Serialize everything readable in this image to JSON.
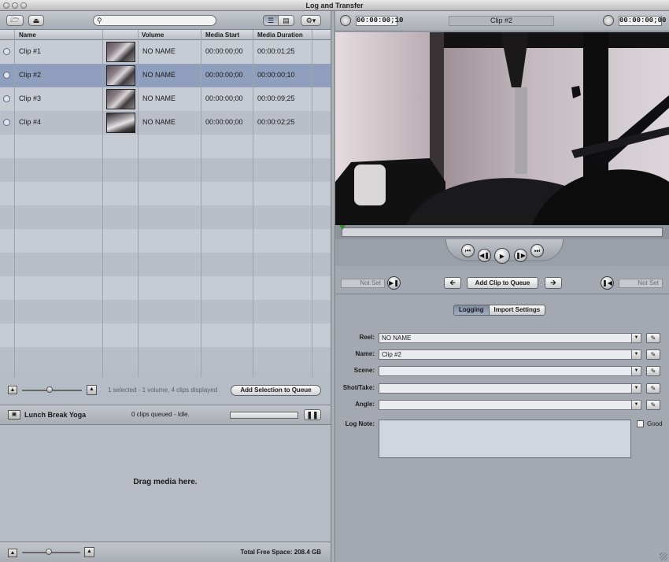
{
  "window": {
    "title": "Log and Transfer"
  },
  "browser": {
    "search_placeholder": "",
    "columns": [
      "Name",
      "",
      "Volume",
      "Media Start",
      "Media Duration"
    ],
    "clips": [
      {
        "name": "Clip #1",
        "volume": "NO NAME",
        "media_start": "00:00:00;00",
        "media_duration": "00:00:01;25",
        "selected": false
      },
      {
        "name": "Clip #2",
        "volume": "NO NAME",
        "media_start": "00:00:00;00",
        "media_duration": "00:00:00;10",
        "selected": true
      },
      {
        "name": "Clip #3",
        "volume": "NO NAME",
        "media_start": "00:00:00;00",
        "media_duration": "00:00:09;25",
        "selected": false
      },
      {
        "name": "Clip #4",
        "volume": "NO NAME",
        "media_start": "00:00:00;00",
        "media_duration": "00:00:02;25",
        "selected": false
      }
    ],
    "status": "1 selected - 1 volume, 4 clips displayed",
    "add_selection_label": "Add Selection to Queue"
  },
  "queue": {
    "project_name": "Lunch Break Yoga",
    "status": "0 clips queued - Idle.",
    "drop_label": "Drag media here.",
    "free_space_label": "Total Free Space: 208.4 GB"
  },
  "viewer": {
    "duration_timecode": "00:00:00;10",
    "clip_name": "Clip #2",
    "current_timecode": "00:00:00;00",
    "in_point": "Not Set",
    "out_point": "Not Set",
    "add_clip_label": "Add Clip to Queue"
  },
  "logging": {
    "tabs": [
      "Logging",
      "Import Settings"
    ],
    "active_tab": "Logging",
    "fields": [
      {
        "label": "Reel:",
        "value": "NO NAME"
      },
      {
        "label": "Name:",
        "value": "Clip #2"
      },
      {
        "label": "Scene:",
        "value": ""
      },
      {
        "label": "Shot/Take:",
        "value": ""
      },
      {
        "label": "Angle:",
        "value": ""
      }
    ],
    "log_note_label": "Log Note:",
    "good_label": "Good"
  },
  "colors": {
    "selected_row": "#8f9fbd",
    "pane_bg": "#b6bcc6"
  }
}
